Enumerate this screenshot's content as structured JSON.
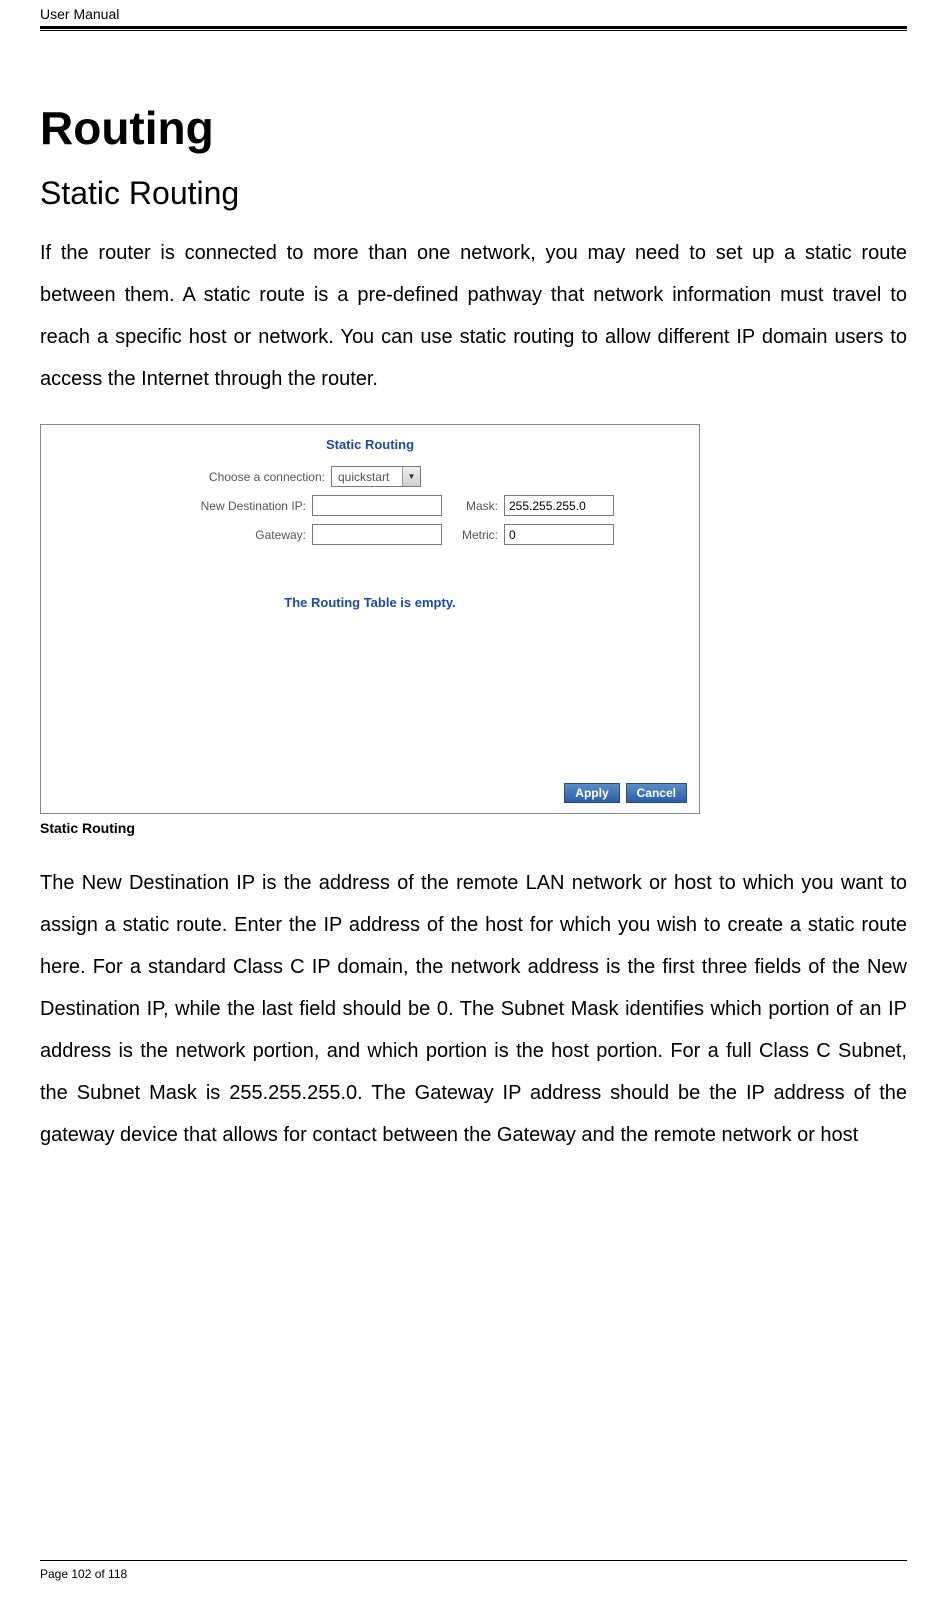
{
  "header": {
    "title": "User Manual"
  },
  "main": {
    "h1": "Routing",
    "h2": "Static Routing",
    "para1": "If the router is connected to more than one network, you may need to set up a static route between them. A static route is a pre-defined pathway that network information must travel to reach a specific host or network. You can use static routing to allow different IP domain users to access the Internet through the router.",
    "caption": "Static Routing",
    "para2": "The New Destination IP is the address of the remote LAN network or host to which you want to assign a static route. Enter the IP address of the host for which you wish to create a static route here. For a standard Class C IP domain, the network address is the first three fields of the New Destination IP, while the last field should be 0. The Subnet Mask identifies which portion of an IP address is the network portion, and which portion is the host portion. For a full Class C Subnet, the Subnet Mask is 255.255.255.0. The Gateway IP address should be the IP address of the gateway device that allows for contact between the Gateway and the remote network or host"
  },
  "screenshot": {
    "title": "Static Routing",
    "labels": {
      "choose_connection": "Choose a connection:",
      "new_dest_ip": "New Destination IP:",
      "mask": "Mask:",
      "gateway": "Gateway:",
      "metric": "Metric:"
    },
    "values": {
      "connection_selected": "quickstart",
      "new_dest_ip": "",
      "mask": "255.255.255.0",
      "gateway": "",
      "metric": "0"
    },
    "empty_message": "The Routing Table is empty.",
    "buttons": {
      "apply": "Apply",
      "cancel": "Cancel"
    }
  },
  "footer": {
    "page_info": "Page 102 of 118"
  }
}
